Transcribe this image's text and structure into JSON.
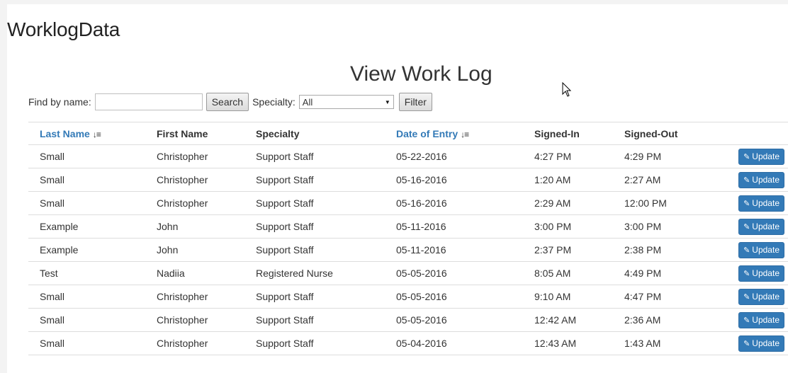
{
  "brand": "WorklogData",
  "heading": "View Work Log",
  "filters": {
    "find_label": "Find by name:",
    "find_value": "",
    "search_label": "Search",
    "specialty_label": "Specialty:",
    "specialty_selected": "All",
    "filter_label": "Filter"
  },
  "table": {
    "headers": {
      "last_name": "Last Name",
      "first_name": "First Name",
      "specialty": "Specialty",
      "date": "Date of Entry",
      "signed_in": "Signed-In",
      "signed_out": "Signed-Out"
    },
    "update_label": "Update",
    "rows": [
      {
        "last": "Small",
        "first": "Christopher",
        "specialty": "Support Staff",
        "date": "05-22-2016",
        "in": "4:27 PM",
        "out": "4:29 PM"
      },
      {
        "last": "Small",
        "first": "Christopher",
        "specialty": "Support Staff",
        "date": "05-16-2016",
        "in": "1:20 AM",
        "out": "2:27 AM"
      },
      {
        "last": "Small",
        "first": "Christopher",
        "specialty": "Support Staff",
        "date": "05-16-2016",
        "in": "2:29 AM",
        "out": "12:00 PM"
      },
      {
        "last": "Example",
        "first": "John",
        "specialty": "Support Staff",
        "date": "05-11-2016",
        "in": "3:00 PM",
        "out": "3:00 PM"
      },
      {
        "last": "Example",
        "first": "John",
        "specialty": "Support Staff",
        "date": "05-11-2016",
        "in": "2:37 PM",
        "out": "2:38 PM"
      },
      {
        "last": "Test",
        "first": "Nadiia",
        "specialty": "Registered Nurse",
        "date": "05-05-2016",
        "in": "8:05 AM",
        "out": "4:49 PM"
      },
      {
        "last": "Small",
        "first": "Christopher",
        "specialty": "Support Staff",
        "date": "05-05-2016",
        "in": "9:10 AM",
        "out": "4:47 PM"
      },
      {
        "last": "Small",
        "first": "Christopher",
        "specialty": "Support Staff",
        "date": "05-05-2016",
        "in": "12:42 AM",
        "out": "2:36 AM"
      },
      {
        "last": "Small",
        "first": "Christopher",
        "specialty": "Support Staff",
        "date": "05-04-2016",
        "in": "12:43 AM",
        "out": "1:43 AM"
      }
    ]
  },
  "colors": {
    "accent": "#337ab7",
    "page_bg": "#ffffff",
    "outer_bg": "#f3f3f3"
  }
}
